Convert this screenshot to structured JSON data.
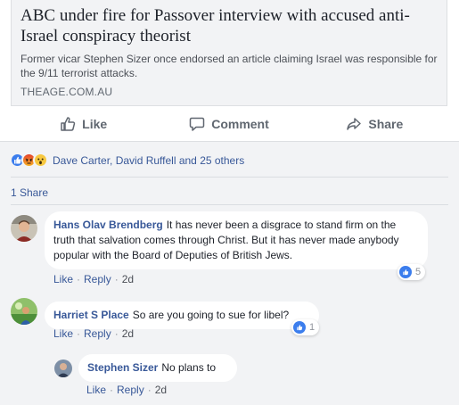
{
  "link_preview": {
    "title": "ABC under fire for Passover interview with accused anti-Israel conspiracy theorist",
    "description": "Former vicar Stephen Sizer once endorsed an article claiming Israel was responsible for the 9/11 terrorist attacks.",
    "domain": "THEAGE.COM.AU"
  },
  "actions": {
    "like": "Like",
    "comment": "Comment",
    "share": "Share"
  },
  "reactions": {
    "icons": [
      "like-icon",
      "angry-icon",
      "wow-icon"
    ],
    "summary": "Dave Carter, David Ruffell and 25 others"
  },
  "shares": "1 Share",
  "comments": [
    {
      "author": "Hans Olav Brendberg",
      "text": "It has never been a disgrace to stand firm on the truth that salvation comes through Christ. But it has never made anybody popular with the Board of Deputies of British Jews.",
      "like": "Like",
      "reply": "Reply",
      "time": "2d",
      "reaction_count": "5"
    },
    {
      "author": "Harriet S Place",
      "text": "So are you going to sue for libel?",
      "like": "Like",
      "reply": "Reply",
      "time": "2d",
      "reaction_count": "1"
    }
  ],
  "reply": {
    "author": "Stephen Sizer",
    "text": "No plans to",
    "like": "Like",
    "reply": "Reply",
    "time": "2d"
  },
  "colors": {
    "link_blue": "#385898",
    "like_blue": "#3b7ded",
    "muted": "#606770",
    "panel_bg": "#f2f3f5"
  }
}
